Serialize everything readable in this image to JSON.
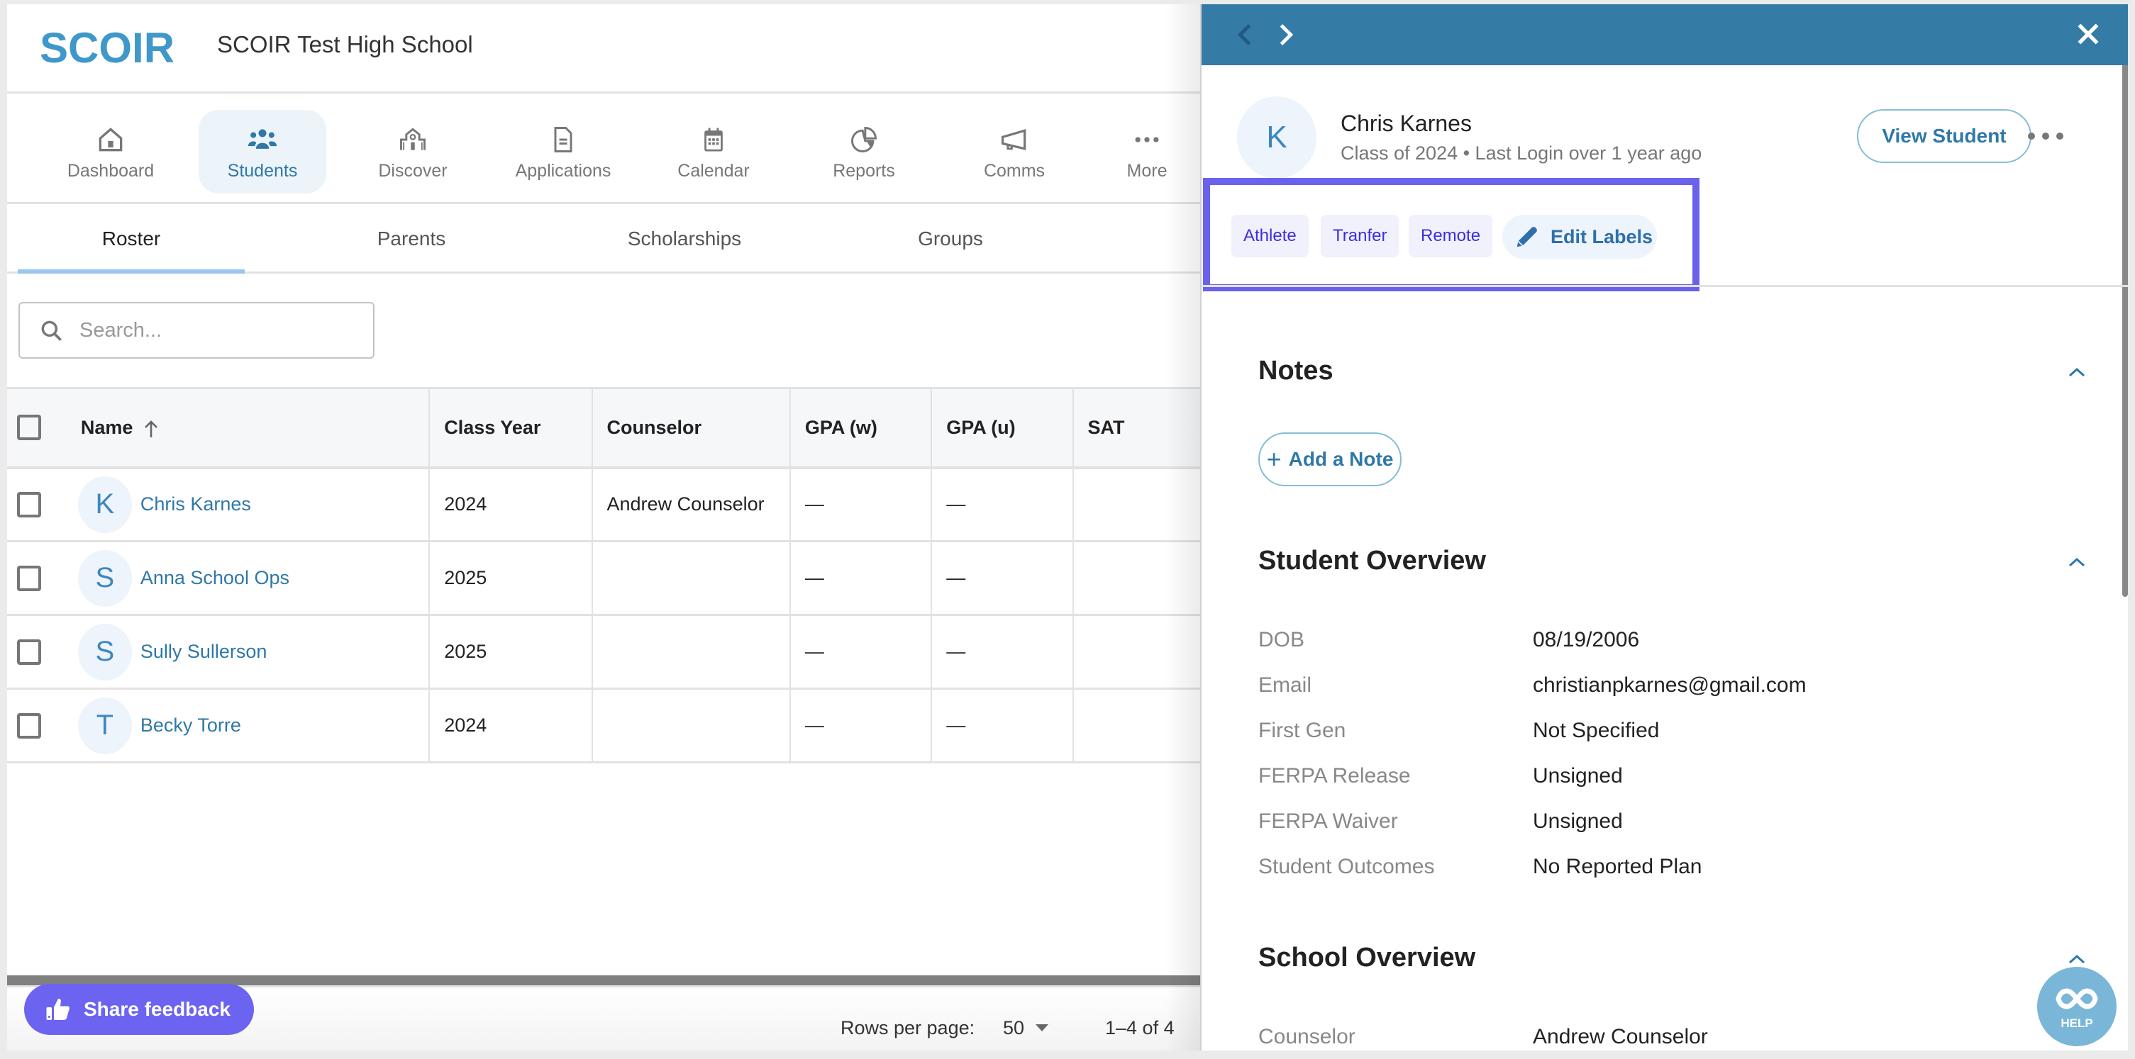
{
  "header": {
    "logo_text": "SCOIR",
    "school_name": "SCOIR Test High School"
  },
  "nav": {
    "items": [
      {
        "label": "Dashboard",
        "icon": "house-icon"
      },
      {
        "label": "Students",
        "icon": "users-icon",
        "active": true
      },
      {
        "label": "Discover",
        "icon": "school-building-icon"
      },
      {
        "label": "Applications",
        "icon": "document-icon"
      },
      {
        "label": "Calendar",
        "icon": "calendar-icon"
      },
      {
        "label": "Reports",
        "icon": "pie-chart-icon"
      },
      {
        "label": "Comms",
        "icon": "megaphone-icon"
      },
      {
        "label": "More",
        "icon": "more-horizontal-icon"
      }
    ]
  },
  "subtabs": {
    "items": [
      {
        "label": "Roster",
        "active": true
      },
      {
        "label": "Parents"
      },
      {
        "label": "Scholarships"
      },
      {
        "label": "Groups"
      }
    ]
  },
  "search": {
    "placeholder": "Search...",
    "value": ""
  },
  "table": {
    "columns": [
      "Name",
      "Class Year",
      "Counselor",
      "GPA (w)",
      "GPA (u)",
      "SAT"
    ],
    "sort": {
      "column": "Name",
      "direction": "ascending"
    },
    "rows": [
      {
        "initial": "K",
        "name": "Chris Karnes",
        "class_year": "2024",
        "counselor": "Andrew Counselor",
        "gpa_w": "—",
        "gpa_u": "—",
        "sat": ""
      },
      {
        "initial": "S",
        "name": "Anna School Ops",
        "class_year": "2025",
        "counselor": "",
        "gpa_w": "—",
        "gpa_u": "—",
        "sat": ""
      },
      {
        "initial": "S",
        "name": "Sully Sullerson",
        "class_year": "2025",
        "counselor": "",
        "gpa_w": "—",
        "gpa_u": "—",
        "sat": ""
      },
      {
        "initial": "T",
        "name": "Becky Torre",
        "class_year": "2024",
        "counselor": "",
        "gpa_w": "—",
        "gpa_u": "—",
        "sat": ""
      }
    ]
  },
  "pagination": {
    "rows_per_page_label": "Rows per page:",
    "rows_per_page": "50",
    "range": "1–4 of 4"
  },
  "feedback_button": "Share feedback",
  "panel": {
    "student": {
      "initial": "K",
      "name": "Chris Karnes",
      "subtitle": "Class of 2024 • Last Login over 1 year ago"
    },
    "view_student_label": "View Student",
    "labels": [
      "Athlete",
      "Tranfer",
      "Remote"
    ],
    "edit_labels": "Edit Labels",
    "notes": {
      "title": "Notes",
      "add_note_label": "Add a Note"
    },
    "student_overview": {
      "title": "Student Overview",
      "fields": [
        {
          "key": "DOB",
          "value": "08/19/2006"
        },
        {
          "key": "Email",
          "value": "christianpkarnes@gmail.com"
        },
        {
          "key": "First Gen",
          "value": "Not Specified"
        },
        {
          "key": "FERPA Release",
          "value": "Unsigned"
        },
        {
          "key": "FERPA Waiver",
          "value": "Unsigned"
        },
        {
          "key": "Student Outcomes",
          "value": "No Reported Plan"
        }
      ]
    },
    "school_overview": {
      "title": "School Overview",
      "fields": [
        {
          "key": "Counselor",
          "value": "Andrew Counselor"
        }
      ]
    }
  },
  "help_button": "HELP",
  "colors": {
    "brand_blue": "#3f98c9",
    "panel_header": "#347ba6",
    "link_blue": "#2f78a8",
    "highlight_purple": "#6b62ec",
    "label_text": "#3a2ee0",
    "feedback_bg": "#6c63f0"
  }
}
